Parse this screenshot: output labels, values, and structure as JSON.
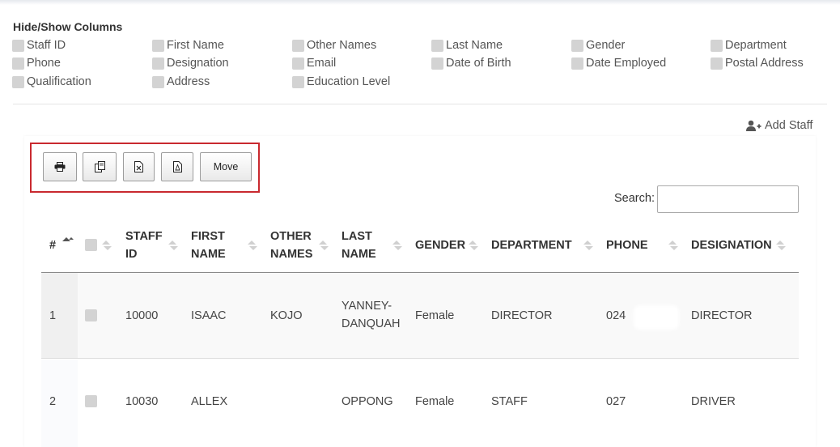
{
  "hide_show": {
    "title": "Hide/Show Columns",
    "columns": [
      "Staff ID",
      "First Name",
      "Other Names",
      "Last Name",
      "Gender",
      "Department",
      "Phone",
      "Designation",
      "Email",
      "Date of Birth",
      "Date Employed",
      "Postal Address",
      "Qualification",
      "Address",
      "Education Level"
    ]
  },
  "add_staff_label": "Add Staff",
  "toolbar": {
    "print_icon": "printer-icon",
    "copy_icon": "copy-icon",
    "excel_icon": "excel-file-icon",
    "pdf_icon": "pdf-file-icon",
    "move_label": "Move"
  },
  "search": {
    "label": "Search:",
    "value": ""
  },
  "table": {
    "headers": {
      "num": "#",
      "staff_id": [
        "STAFF",
        "ID"
      ],
      "first_name": [
        "FIRST",
        "NAME"
      ],
      "other_names": [
        "OTHER",
        "NAMES"
      ],
      "last_name": [
        "LAST",
        "NAME"
      ],
      "gender": "GENDER",
      "department": "DEPARTMENT",
      "phone": "PHONE",
      "designation": "DESIGNATION"
    },
    "rows": [
      {
        "num": "1",
        "staff_id": "10000",
        "first_name": "ISAAC",
        "other_names": "KOJO",
        "last_name": [
          "YANNEY-",
          "DANQUAH"
        ],
        "gender": "Female",
        "department": "DIRECTOR",
        "phone": "024",
        "designation": "DIRECTOR"
      },
      {
        "num": "2",
        "staff_id": "10030",
        "first_name": "ALLEX",
        "other_names": "",
        "last_name": [
          "OPPONG"
        ],
        "gender": "Female",
        "department": "STAFF",
        "phone": "027",
        "designation": "DRIVER"
      }
    ]
  },
  "colors": {
    "accent_frame": "#c9292f",
    "checkbox": "#d3d3d3",
    "header_rule": "#8a8a8a"
  }
}
